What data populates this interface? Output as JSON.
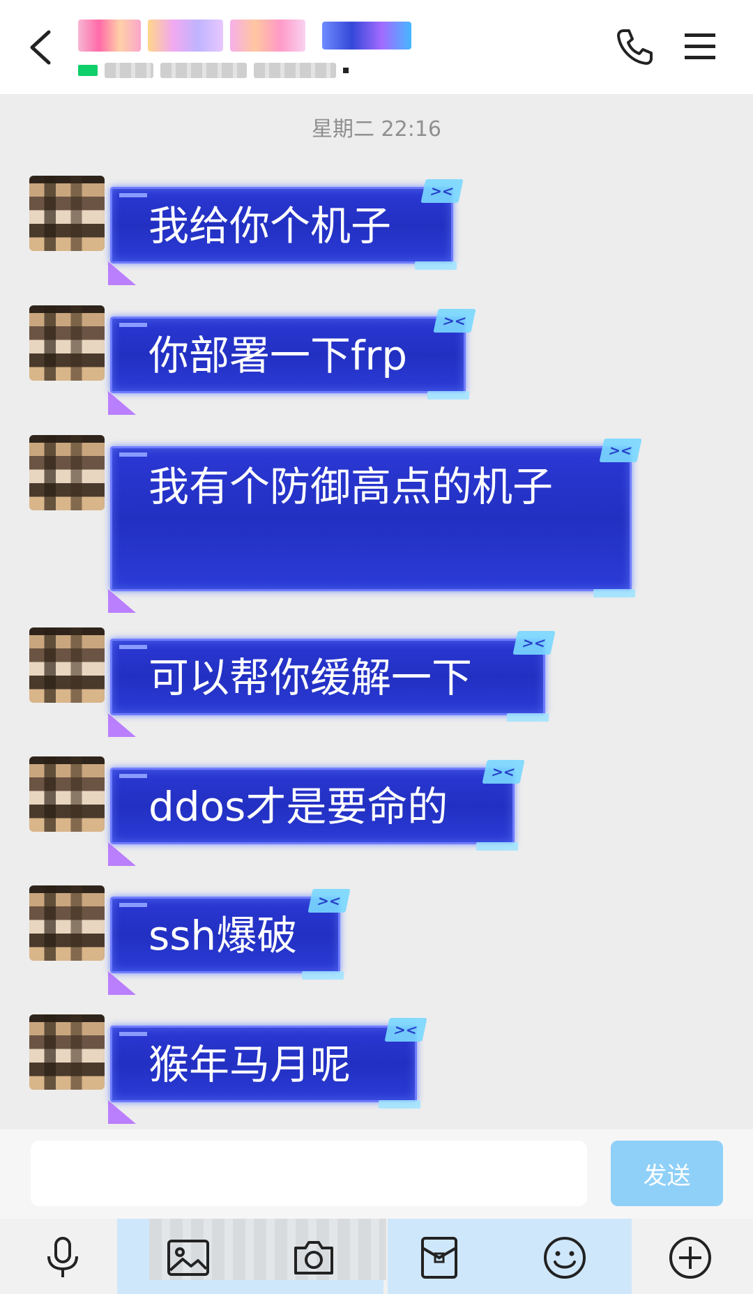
{
  "header": {
    "back_icon": "chevron-left-icon",
    "phone_icon": "phone-icon",
    "menu_icon": "menu-icon"
  },
  "timestamp": "星期二 22:16",
  "messages": [
    {
      "text": "我给你个机子"
    },
    {
      "text": "你部署一下frp"
    },
    {
      "text": "我有个防御高点的机子"
    },
    {
      "text": "可以帮你缓解一下"
    },
    {
      "text": "ddos才是要命的"
    },
    {
      "text": "ssh爆破"
    },
    {
      "text": "猴年马月呢"
    }
  ],
  "input": {
    "placeholder": "",
    "send_label": "发送"
  },
  "toolbar": {
    "items": [
      "microphone-icon",
      "image-icon",
      "camera-icon",
      "red-packet-icon",
      "emoji-icon",
      "plus-icon"
    ]
  },
  "colors": {
    "bubble": "#2230c2",
    "send": "#8fd0f8",
    "online": "#0fcf6a"
  }
}
